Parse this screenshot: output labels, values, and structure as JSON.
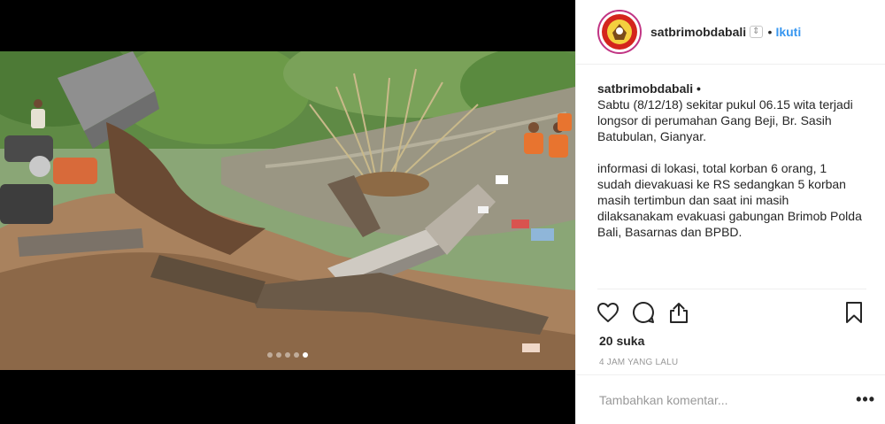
{
  "post": {
    "username": "satbrimobdabali",
    "follow_label": "Ikuti",
    "separator": "•",
    "caption": {
      "username": "satbrimobdabali",
      "dot": "•",
      "paragraph_1": "Sabtu (8/12/18) sekitar pukul 06.15 wita terjadi longsor di perumahan Gang Beji, Br. Sasih Batubulan, Gianyar.",
      "paragraph_2": "informasi di lokasi, total korban 6 orang, 1 sudah dievakuasi ke RS sedangkan 5 korban masih tertimbun dan saat ini masih dilaksanakam evakuasi gabungan Brimob Polda Bali, Basarnas dan BPBD."
    },
    "likes": "20 suka",
    "timestamp": "4 JAM YANG LALU",
    "comment_placeholder": "Tambahkan komentar...",
    "more_label": "•••"
  },
  "media": {
    "carousel_count": 5,
    "carousel_active_index": 4
  },
  "icons": {
    "like": "heart-icon",
    "comment": "comment-icon",
    "share": "share-icon",
    "save": "bookmark-icon"
  },
  "colors": {
    "follow": "#3897f0",
    "avatar_ring": "#c13584",
    "text": "#262626",
    "muted": "#999999"
  }
}
